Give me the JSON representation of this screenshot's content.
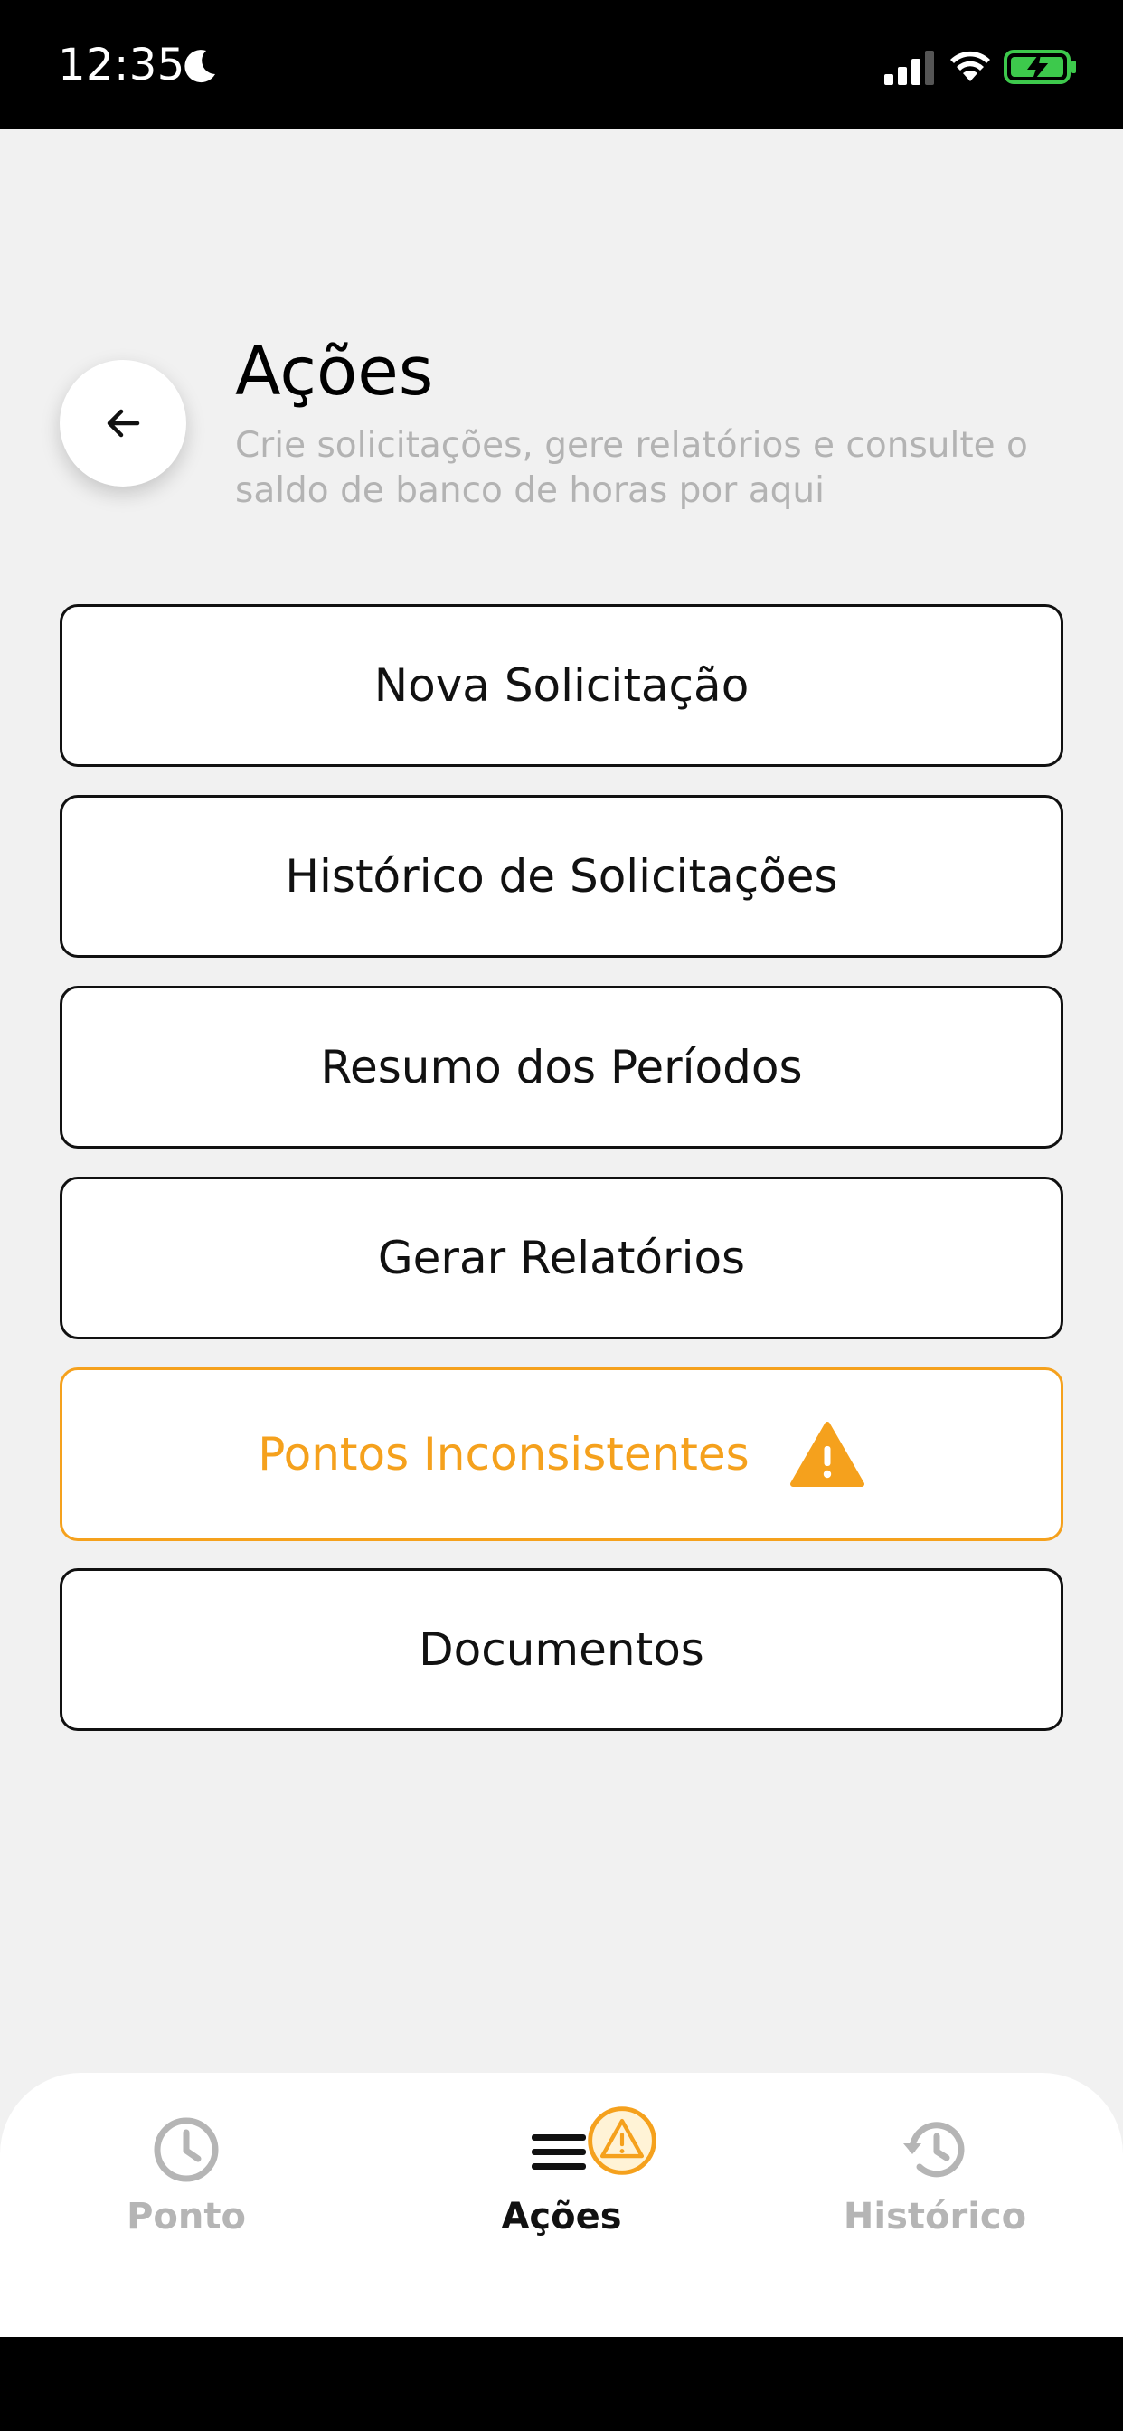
{
  "status_bar": {
    "time": "12:35"
  },
  "header": {
    "title": "Ações",
    "subtitle": "Crie solicitações, gere relatórios e consulte o saldo de banco de horas por aqui"
  },
  "actions": [
    {
      "label": "Nova Solicitação"
    },
    {
      "label": "Histórico de Solicitações"
    },
    {
      "label": "Resumo dos Períodos"
    },
    {
      "label": "Gerar Relatórios"
    },
    {
      "label": "Pontos Inconsistentes",
      "icon": "warning-icon"
    },
    {
      "label": "Documentos"
    }
  ],
  "bottom_nav": {
    "items": [
      {
        "label": "Ponto",
        "icon": "clock-icon"
      },
      {
        "label": "Ações",
        "icon": "menu-icon",
        "badge": "warning-badge-icon"
      },
      {
        "label": "Histórico",
        "icon": "history-icon"
      }
    ],
    "active": "Ações"
  },
  "colors": {
    "warning": "#f5a11d",
    "text": "#111111",
    "muted": "#b3b3b3",
    "background": "#f1f1f1"
  }
}
